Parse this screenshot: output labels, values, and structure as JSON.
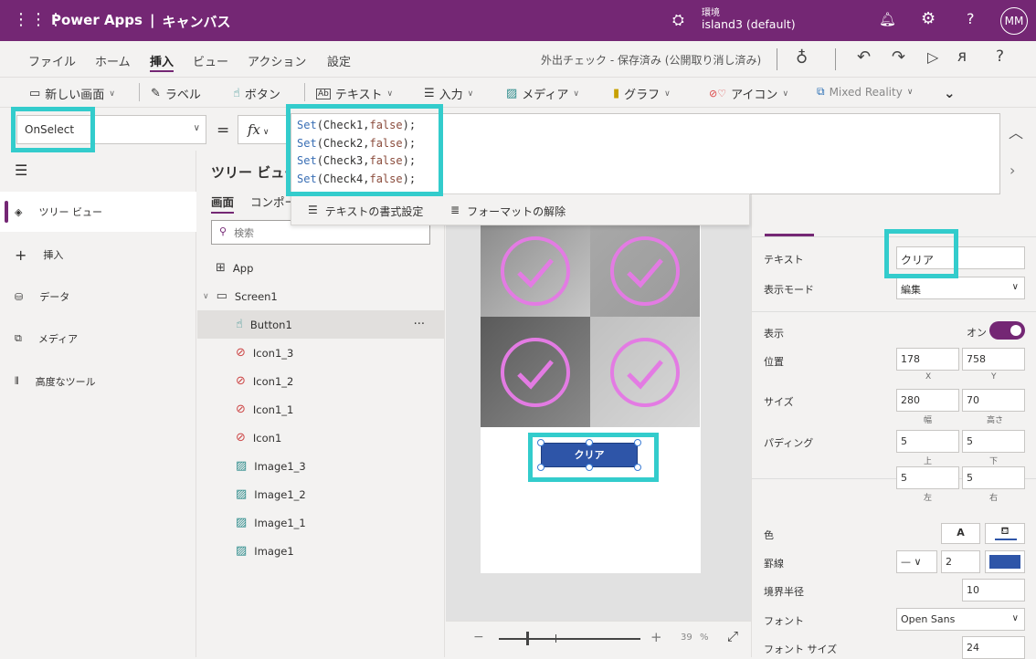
{
  "header": {
    "app_name": "Power Apps",
    "separator": "|",
    "app_type": "キャンバス",
    "env_label": "環境",
    "env_name": "island3 (default)",
    "avatar": "MM"
  },
  "menu": {
    "items": [
      "ファイル",
      "ホーム",
      "挿入",
      "ビュー",
      "アクション",
      "設定"
    ],
    "active": "挿入",
    "status": "外出チェック - 保存済み (公開取り消し済み)"
  },
  "toolbar": {
    "items": [
      "新しい画面",
      "ラベル",
      "ボタン",
      "テキスト",
      "入力",
      "メディア",
      "グラフ",
      "アイコン",
      "Mixed Reality"
    ]
  },
  "formula": {
    "property": "OnSelect",
    "equals": "=",
    "fx": "fx",
    "lines": [
      {
        "fn": "Set",
        "arg": "(Check1,",
        "val": "false",
        "end": ");"
      },
      {
        "fn": "Set",
        "arg": "(Check2,",
        "val": "false",
        "end": ");"
      },
      {
        "fn": "Set",
        "arg": "(Check3,",
        "val": "false",
        "end": ");"
      },
      {
        "fn": "Set",
        "arg": "(Check4,",
        "val": "false",
        "end": ");"
      }
    ],
    "format_text": "テキストの書式設定",
    "remove_format": "フォーマットの解除"
  },
  "leftnav": {
    "items": [
      "ツリー ビュー",
      "挿入",
      "データ",
      "メディア",
      "高度なツール"
    ]
  },
  "tree": {
    "title": "ツリー ビュー",
    "tabs": [
      "画面",
      "コンポーネント"
    ],
    "search_placeholder": "検索",
    "items": [
      "App",
      "Screen1",
      "Button1",
      "Icon1_3",
      "Icon1_2",
      "Icon1_1",
      "Icon1",
      "Image1_3",
      "Image1_2",
      "Image1_1",
      "Image1"
    ],
    "more": "···"
  },
  "canvas": {
    "button_text": "クリア",
    "zoom_value": "39",
    "zoom_unit": "%",
    "zoom_minus": "−",
    "zoom_plus": "+"
  },
  "props": {
    "text_label": "テキスト",
    "text_value": "クリア",
    "display_mode_label": "表示モード",
    "display_mode_value": "編集",
    "visible_label": "表示",
    "visible_value": "オン",
    "position_label": "位置",
    "x": "178",
    "y": "758",
    "x_label": "X",
    "y_label": "Y",
    "size_label": "サイズ",
    "width": "280",
    "height": "70",
    "width_label": "幅",
    "height_label": "高さ",
    "padding_label": "パディング",
    "pad_top": "5",
    "pad_bottom": "5",
    "pad_left": "5",
    "pad_right": "5",
    "top_label": "上",
    "bottom_label": "下",
    "left_label": "左",
    "right_label": "右",
    "color_label": "色",
    "color_a": "A",
    "border_label": "罫線",
    "border_width": "2",
    "radius_label": "境界半径",
    "radius": "10",
    "font_label": "フォント",
    "font": "Open Sans",
    "font_size_label": "フォント サイズ",
    "font_size": "24"
  },
  "colors": {
    "brand": "#742774",
    "highlight": "#33cccc",
    "button": "#2e55a8",
    "check": "#e37be3"
  }
}
